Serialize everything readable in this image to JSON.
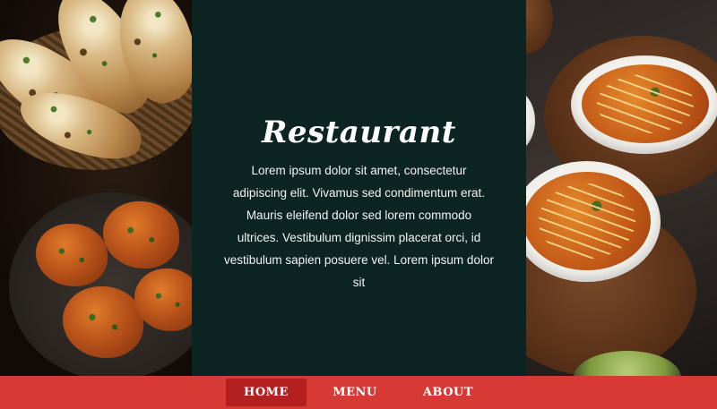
{
  "hero": {
    "title": "Restaurant",
    "description": "Lorem ipsum dolor sit amet, consectetur adipiscing elit. Vivamus sed condimentum erat. Mauris eleifend dolor sed lorem commodo ultrices. Vestibulum dignissim placerat orci, id vestibulum sapien posuere vel. Lorem ipsum dolor sit",
    "left_image": "naan-and-pakora-photo",
    "right_image": "curry-bowls-photo"
  },
  "nav": {
    "items": [
      {
        "label": "HOME",
        "active": true
      },
      {
        "label": "MENU",
        "active": false
      },
      {
        "label": "ABOUT",
        "active": false
      }
    ]
  },
  "colors": {
    "panel_bg": "#0c2422",
    "nav_bg": "#d73a35",
    "nav_active_bg": "#b3201f",
    "text": "#ffffff"
  }
}
